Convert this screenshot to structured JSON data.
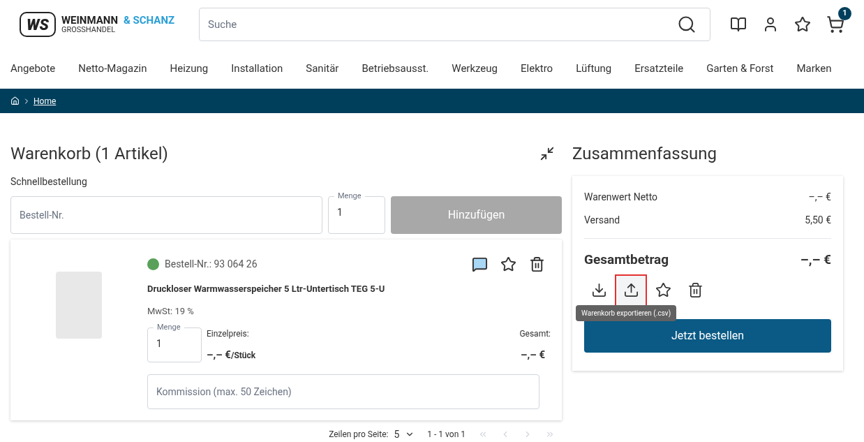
{
  "header": {
    "logo": {
      "mark": "WS",
      "name": "WEINMANN",
      "name_accent": "& SCHANZ",
      "subtitle": "GROSSHANDEL"
    },
    "search": {
      "placeholder": "Suche"
    },
    "cart_count": "1"
  },
  "nav": [
    "Angebote",
    "Netto-Magazin",
    "Heizung",
    "Installation",
    "Sanitär",
    "Betriebsausst.",
    "Werkzeug",
    "Elektro",
    "Lüftung",
    "Ersatzteile",
    "Garten & Forst",
    "Marken"
  ],
  "breadcrumb": [
    "Home"
  ],
  "cart": {
    "title": "Warenkorb (1 Artikel)",
    "quick_order": {
      "label": "Schnellbestellung",
      "order_field": {
        "placeholder": "Bestell-Nr."
      },
      "quantity_label": "Menge",
      "quantity": "1",
      "button": {
        "label": "Hinzufügen",
        "disabled": true
      }
    },
    "items": [
      {
        "color": "#5aa05a",
        "order_no": "Bestell-Nr.: 93 064 26",
        "name": "Druckloser Warmwasserspeicher 5 Ltr-Untertisch TEG 5-U",
        "vat": "MwSt: 19 %",
        "quantity_label": "Menge",
        "quantity": "1",
        "unit_price_label": "Einzelpreis:",
        "unit_price": "–,– €",
        "unit": "/Stück",
        "total_label": "Gesamt:",
        "total": "–,– €",
        "commission": {
          "placeholder": "Kommission (max. 50 Zeichen)"
        }
      }
    ],
    "pagination": {
      "rows_label": "Zeilen pro Seite:",
      "rows": "5",
      "range": "1 - 1 von 1",
      "first_disabled": true,
      "prev_disabled": true,
      "next_disabled": true,
      "last_disabled": true
    }
  },
  "summary": {
    "title": "Zusammenfassung",
    "lines": [
      {
        "label": "Warenwert Netto",
        "value": "–,– €"
      },
      {
        "label": "Versand",
        "value": "5,50 €"
      }
    ],
    "total_label": "Gesamtbetrag",
    "total": "–,– €",
    "actions": [
      {
        "kind": "download",
        "highlighted": false
      },
      {
        "kind": "upload",
        "highlighted": true
      },
      {
        "kind": "star",
        "highlighted": false
      },
      {
        "kind": "trash",
        "highlighted": false
      }
    ],
    "tooltip": "Warenkorb exportieren (.csv)",
    "order_button": "Jetzt bestellen"
  }
}
